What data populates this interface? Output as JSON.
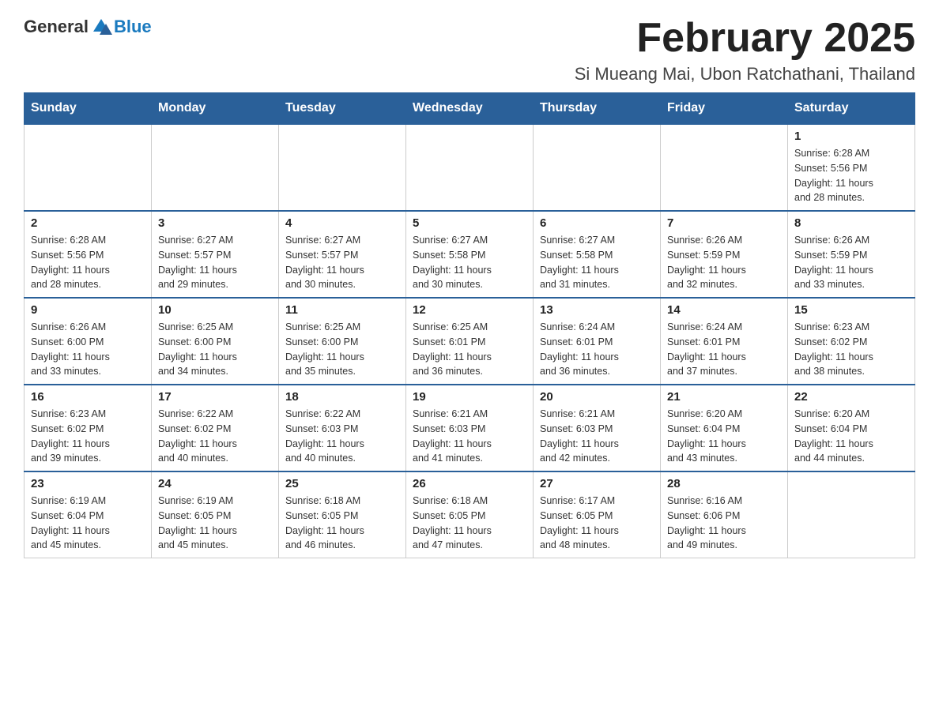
{
  "header": {
    "logo": {
      "text_general": "General",
      "text_blue": "Blue"
    },
    "title": "February 2025",
    "subtitle": "Si Mueang Mai, Ubon Ratchathani, Thailand"
  },
  "days_of_week": [
    "Sunday",
    "Monday",
    "Tuesday",
    "Wednesday",
    "Thursday",
    "Friday",
    "Saturday"
  ],
  "weeks": [
    [
      {
        "day": "",
        "info": ""
      },
      {
        "day": "",
        "info": ""
      },
      {
        "day": "",
        "info": ""
      },
      {
        "day": "",
        "info": ""
      },
      {
        "day": "",
        "info": ""
      },
      {
        "day": "",
        "info": ""
      },
      {
        "day": "1",
        "info": "Sunrise: 6:28 AM\nSunset: 5:56 PM\nDaylight: 11 hours\nand 28 minutes."
      }
    ],
    [
      {
        "day": "2",
        "info": "Sunrise: 6:28 AM\nSunset: 5:56 PM\nDaylight: 11 hours\nand 28 minutes."
      },
      {
        "day": "3",
        "info": "Sunrise: 6:27 AM\nSunset: 5:57 PM\nDaylight: 11 hours\nand 29 minutes."
      },
      {
        "day": "4",
        "info": "Sunrise: 6:27 AM\nSunset: 5:57 PM\nDaylight: 11 hours\nand 30 minutes."
      },
      {
        "day": "5",
        "info": "Sunrise: 6:27 AM\nSunset: 5:58 PM\nDaylight: 11 hours\nand 30 minutes."
      },
      {
        "day": "6",
        "info": "Sunrise: 6:27 AM\nSunset: 5:58 PM\nDaylight: 11 hours\nand 31 minutes."
      },
      {
        "day": "7",
        "info": "Sunrise: 6:26 AM\nSunset: 5:59 PM\nDaylight: 11 hours\nand 32 minutes."
      },
      {
        "day": "8",
        "info": "Sunrise: 6:26 AM\nSunset: 5:59 PM\nDaylight: 11 hours\nand 33 minutes."
      }
    ],
    [
      {
        "day": "9",
        "info": "Sunrise: 6:26 AM\nSunset: 6:00 PM\nDaylight: 11 hours\nand 33 minutes."
      },
      {
        "day": "10",
        "info": "Sunrise: 6:25 AM\nSunset: 6:00 PM\nDaylight: 11 hours\nand 34 minutes."
      },
      {
        "day": "11",
        "info": "Sunrise: 6:25 AM\nSunset: 6:00 PM\nDaylight: 11 hours\nand 35 minutes."
      },
      {
        "day": "12",
        "info": "Sunrise: 6:25 AM\nSunset: 6:01 PM\nDaylight: 11 hours\nand 36 minutes."
      },
      {
        "day": "13",
        "info": "Sunrise: 6:24 AM\nSunset: 6:01 PM\nDaylight: 11 hours\nand 36 minutes."
      },
      {
        "day": "14",
        "info": "Sunrise: 6:24 AM\nSunset: 6:01 PM\nDaylight: 11 hours\nand 37 minutes."
      },
      {
        "day": "15",
        "info": "Sunrise: 6:23 AM\nSunset: 6:02 PM\nDaylight: 11 hours\nand 38 minutes."
      }
    ],
    [
      {
        "day": "16",
        "info": "Sunrise: 6:23 AM\nSunset: 6:02 PM\nDaylight: 11 hours\nand 39 minutes."
      },
      {
        "day": "17",
        "info": "Sunrise: 6:22 AM\nSunset: 6:02 PM\nDaylight: 11 hours\nand 40 minutes."
      },
      {
        "day": "18",
        "info": "Sunrise: 6:22 AM\nSunset: 6:03 PM\nDaylight: 11 hours\nand 40 minutes."
      },
      {
        "day": "19",
        "info": "Sunrise: 6:21 AM\nSunset: 6:03 PM\nDaylight: 11 hours\nand 41 minutes."
      },
      {
        "day": "20",
        "info": "Sunrise: 6:21 AM\nSunset: 6:03 PM\nDaylight: 11 hours\nand 42 minutes."
      },
      {
        "day": "21",
        "info": "Sunrise: 6:20 AM\nSunset: 6:04 PM\nDaylight: 11 hours\nand 43 minutes."
      },
      {
        "day": "22",
        "info": "Sunrise: 6:20 AM\nSunset: 6:04 PM\nDaylight: 11 hours\nand 44 minutes."
      }
    ],
    [
      {
        "day": "23",
        "info": "Sunrise: 6:19 AM\nSunset: 6:04 PM\nDaylight: 11 hours\nand 45 minutes."
      },
      {
        "day": "24",
        "info": "Sunrise: 6:19 AM\nSunset: 6:05 PM\nDaylight: 11 hours\nand 45 minutes."
      },
      {
        "day": "25",
        "info": "Sunrise: 6:18 AM\nSunset: 6:05 PM\nDaylight: 11 hours\nand 46 minutes."
      },
      {
        "day": "26",
        "info": "Sunrise: 6:18 AM\nSunset: 6:05 PM\nDaylight: 11 hours\nand 47 minutes."
      },
      {
        "day": "27",
        "info": "Sunrise: 6:17 AM\nSunset: 6:05 PM\nDaylight: 11 hours\nand 48 minutes."
      },
      {
        "day": "28",
        "info": "Sunrise: 6:16 AM\nSunset: 6:06 PM\nDaylight: 11 hours\nand 49 minutes."
      },
      {
        "day": "",
        "info": ""
      }
    ]
  ]
}
